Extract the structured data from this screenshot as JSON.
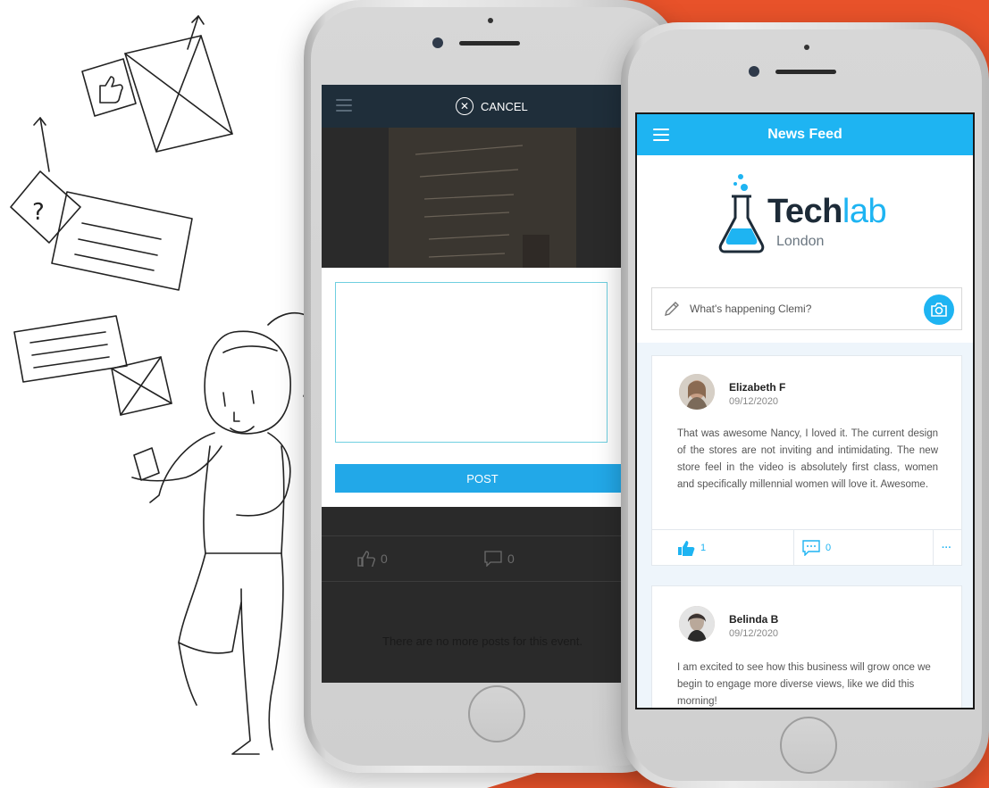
{
  "colors": {
    "accent_orange": "#e8522a",
    "brand_blue": "#1eb4f2",
    "post_blue": "#22a8e8",
    "dark_header": "#1f2e3a"
  },
  "left_phone": {
    "cancel_label": "CANCEL",
    "post_label": "POST",
    "like_count": "0",
    "comment_count": "0",
    "no_more_posts": "There are no more posts for this event."
  },
  "right_phone": {
    "header_title": "News Feed",
    "logo": {
      "word_a": "Tech",
      "word_b": "lab",
      "city": "London"
    },
    "composer_placeholder": "What's happening Clemi?",
    "posts": [
      {
        "author": "Elizabeth F",
        "date": "09/12/2020",
        "text": "That was awesome Nancy, I loved it. The current design of the stores are not inviting and intimidating. The new store feel in the video is absolutely first class, women and specifically millennial women will love it. Awesome.",
        "likes": "1",
        "comments": "0",
        "more": "···"
      },
      {
        "author": "Belinda B",
        "date": "09/12/2020",
        "text": "I am excited to see how this business will grow once we begin to engage more diverse views, like we did this morning!"
      }
    ]
  },
  "icons": [
    "menu-icon",
    "close-circle-icon",
    "pencil-icon",
    "camera-icon",
    "thumbs-up-icon",
    "comment-icon",
    "more-icon"
  ]
}
